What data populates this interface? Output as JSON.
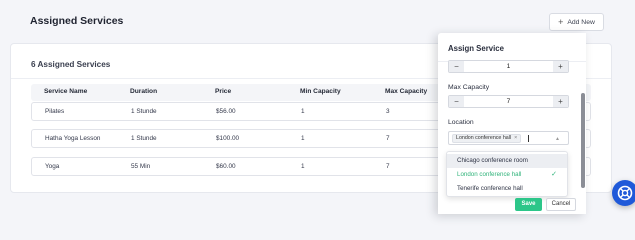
{
  "header": {
    "title": "Assigned Services",
    "add_new_label": "Add New",
    "add_icon": "plus-icon"
  },
  "services_card": {
    "title": "6 Assigned Services",
    "columns": [
      "Service Name",
      "Duration",
      "Price",
      "Min Capacity",
      "Max Capacity"
    ],
    "rows": [
      {
        "name": "Pilates",
        "duration": "1 Stunde",
        "price": "$56.00",
        "min": "1",
        "max": "3"
      },
      {
        "name": "Hatha Yoga Lesson",
        "duration": "1 Stunde",
        "price": "$100.00",
        "min": "1",
        "max": "7"
      },
      {
        "name": "Yoga",
        "duration": "55 Min",
        "price": "$60.00",
        "min": "1",
        "max": "7"
      }
    ]
  },
  "assign_panel": {
    "title": "Assign Service",
    "min_capacity_value": "1",
    "max_capacity_label": "Max Capacity",
    "max_capacity_value": "7",
    "location_label": "Location",
    "selected_tag": "London conference hall",
    "tag_remove_icon": "close-icon",
    "dropdown_options": [
      {
        "label": "Chicago conference room",
        "selected": false,
        "hover": true
      },
      {
        "label": "London conference hall",
        "selected": true,
        "hover": false
      },
      {
        "label": "Tenerife conference hall",
        "selected": false,
        "hover": false
      }
    ],
    "save_label": "Save",
    "cancel_label": "Cancel"
  },
  "colors": {
    "accent_green": "#2cc689",
    "help_blue": "#1f59d9"
  },
  "help_icon": "lifebuoy-icon"
}
